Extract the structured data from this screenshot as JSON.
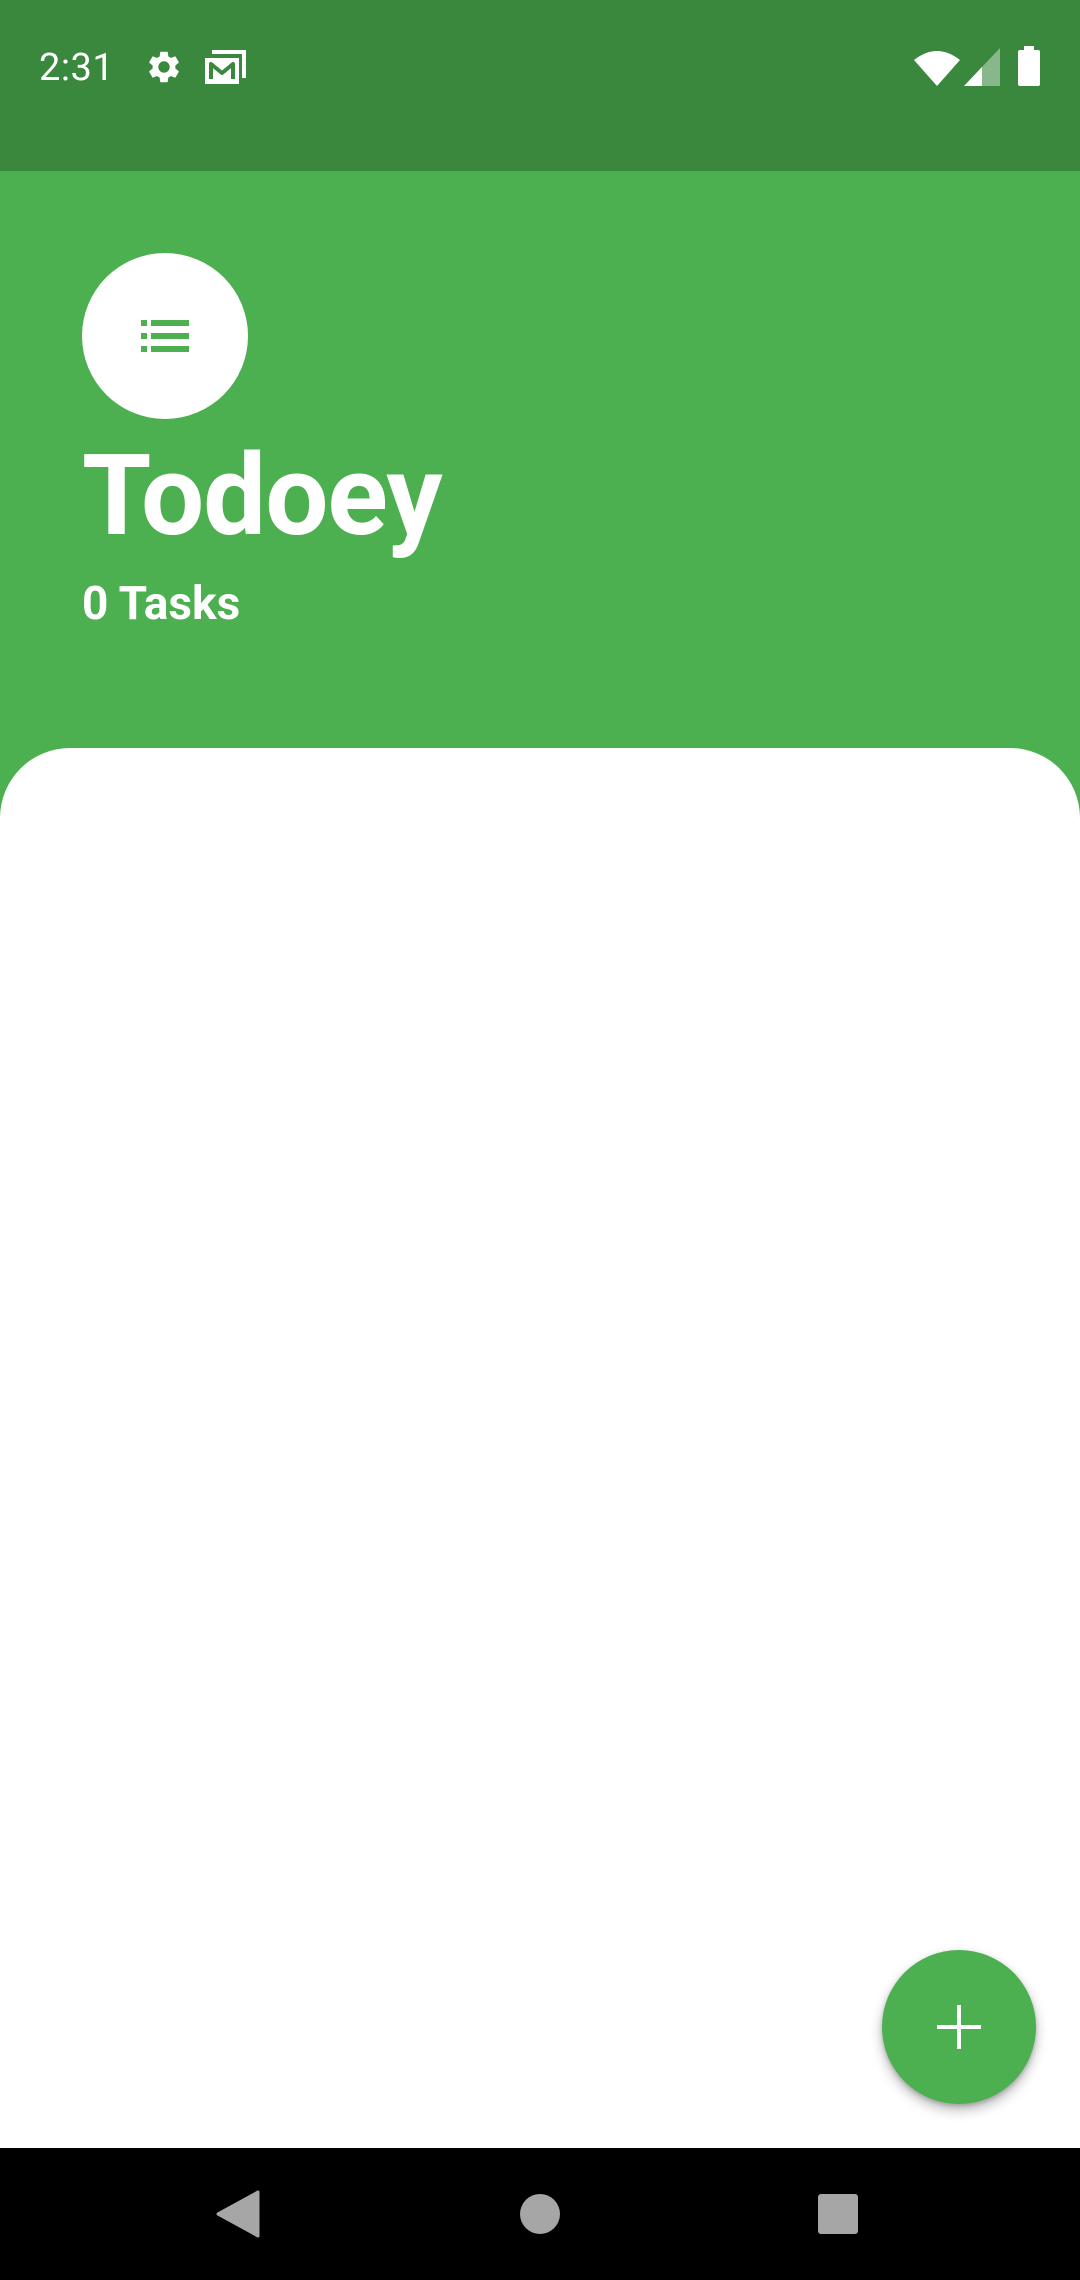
{
  "status_bar": {
    "time": "2:31",
    "icons": [
      "gear-icon",
      "photo-mail-icon",
      "wifi-icon",
      "signal-icon",
      "battery-icon"
    ]
  },
  "header": {
    "logo_icon": "list-icon",
    "title": "Todoey",
    "task_count": "0 Tasks"
  },
  "tasks": [],
  "fab": {
    "icon": "add-icon"
  },
  "nav": {
    "icons": [
      "back-icon",
      "home-icon",
      "recents-icon"
    ]
  },
  "colors": {
    "status_bar": "#3A873E",
    "primary": "#4CAF50",
    "surface": "#FFFFFF",
    "nav_bar": "#000000"
  }
}
